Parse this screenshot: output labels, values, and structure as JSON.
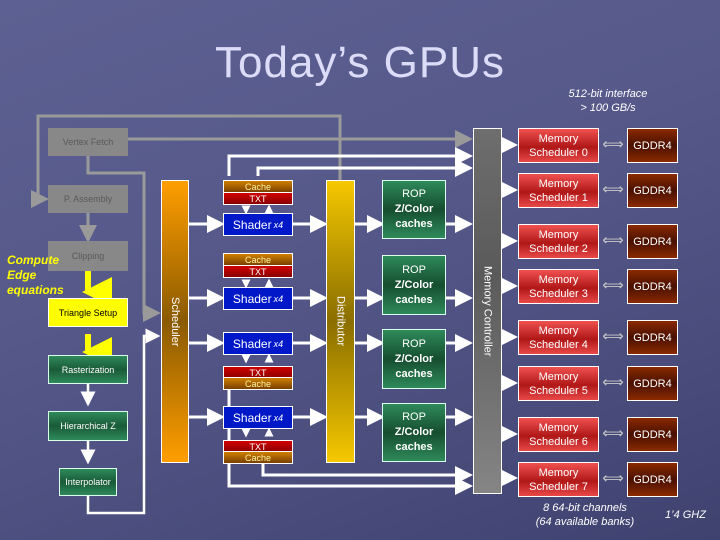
{
  "slide": {
    "title": "Today’s GPUs",
    "interface_note": [
      "512-bit interface",
      "> 100 GB/s"
    ],
    "channels_note": [
      "8 64-bit channels",
      "(64 available banks)"
    ],
    "clock_note": "1’4 GHZ"
  },
  "front_end": {
    "vertex_fetch": "Vertex Fetch",
    "primitive_assembly": "P. Assembly",
    "clipping": "Clipping",
    "triangle_setup": "Triangle Setup",
    "rasterization": "Rasterization",
    "hierarchical_z": "Hierarchical Z",
    "interpolator": "Interpolator",
    "edge_annotation": [
      "Compute",
      "Edge",
      "equations"
    ]
  },
  "scheduler": {
    "label": "Scheduler"
  },
  "distributor": {
    "label": "Distributor"
  },
  "memory_controller": {
    "label": "Memory Controller"
  },
  "shader_units": [
    {
      "label": "Shader",
      "multiplier": "x4",
      "cache": "Cache",
      "txt": "TXT"
    },
    {
      "label": "Shader",
      "multiplier": "x4",
      "cache": "Cache",
      "txt": "TXT"
    },
    {
      "label": "Shader",
      "multiplier": "x4",
      "cache": "Cache",
      "txt": "TXT"
    },
    {
      "label": "Shader",
      "multiplier": "x4",
      "cache": "Cache",
      "txt": "TXT"
    }
  ],
  "rop_units": [
    {
      "line1": "ROP",
      "line2": "Z/Color",
      "line3": "caches"
    },
    {
      "line1": "ROP",
      "line2": "Z/Color",
      "line3": "caches"
    },
    {
      "line1": "ROP",
      "line2": "Z/Color",
      "line3": "caches"
    },
    {
      "line1": "ROP",
      "line2": "Z/Color",
      "line3": "caches"
    }
  ],
  "memory_channels": [
    {
      "scheduler_line1": "Memory",
      "scheduler_line2": "Scheduler 0",
      "dram": "GDDR4"
    },
    {
      "scheduler_line1": "Memory",
      "scheduler_line2": "Scheduler 1",
      "dram": "GDDR4"
    },
    {
      "scheduler_line1": "Memory",
      "scheduler_line2": "Scheduler 2",
      "dram": "GDDR4"
    },
    {
      "scheduler_line1": "Memory",
      "scheduler_line2": "Scheduler 3",
      "dram": "GDDR4"
    },
    {
      "scheduler_line1": "Memory",
      "scheduler_line2": "Scheduler 4",
      "dram": "GDDR4"
    },
    {
      "scheduler_line1": "Memory",
      "scheduler_line2": "Scheduler 5",
      "dram": "GDDR4"
    },
    {
      "scheduler_line1": "Memory",
      "scheduler_line2": "Scheduler 6",
      "dram": "GDDR4"
    },
    {
      "scheduler_line1": "Memory",
      "scheduler_line2": "Scheduler 7",
      "dram": "GDDR4"
    }
  ],
  "icons": {
    "bidirectional_arrow": "⟺"
  },
  "colors": {
    "scheduler": "#ff9e00",
    "distributor": "#f5c800",
    "shader": "#0018c8",
    "txt": "#d00000",
    "cache": "#d08000",
    "rop": "#2e8a5a",
    "memory_scheduler": "#e84848",
    "gddr4": "#6a1e00",
    "highlight": "#ffff00"
  }
}
